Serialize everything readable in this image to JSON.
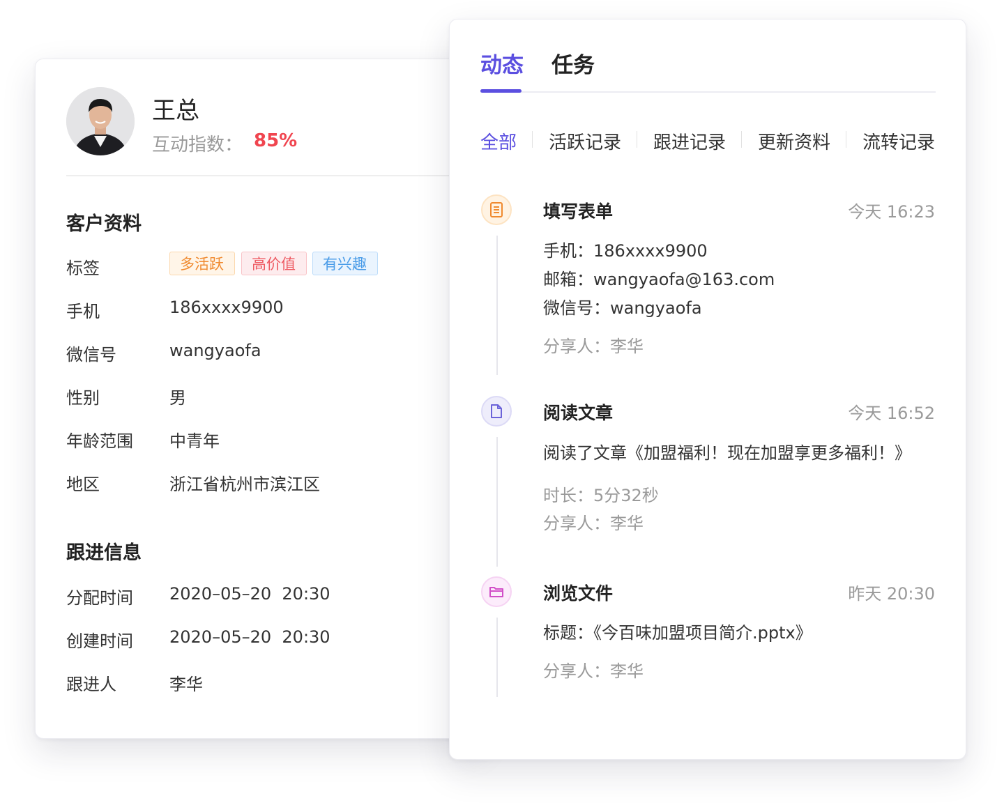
{
  "profile": {
    "name": "王总",
    "score_label": "互动指数：",
    "score_value": "85%"
  },
  "customer_info": {
    "title": "客户资料",
    "tags_label": "标签",
    "tags": [
      "多活跃",
      "高价值",
      "有兴趣"
    ],
    "rows": [
      {
        "label": "手机",
        "value": "186xxxx9900"
      },
      {
        "label": "微信号",
        "value": "wangyaofa"
      },
      {
        "label": "性别",
        "value": "男"
      },
      {
        "label": "年龄范围",
        "value": "中青年"
      },
      {
        "label": "地区",
        "value": "浙江省杭州市滨江区"
      }
    ]
  },
  "follow_info": {
    "title": "跟进信息",
    "rows": [
      {
        "label": "分配时间",
        "value": "2020–05–20  20:30"
      },
      {
        "label": "创建时间",
        "value": "2020–05–20  20:30"
      },
      {
        "label": "跟进人",
        "value": "李华"
      }
    ]
  },
  "tabs": [
    "动态",
    "任务"
  ],
  "active_tab": "动态",
  "filters": [
    "全部",
    "活跃记录",
    "跟进记录",
    "更新资料",
    "流转记录"
  ],
  "active_filter": "全部",
  "timeline": [
    {
      "icon": "form-icon",
      "title": "填写表单",
      "time": "今天 16:23",
      "lines": [
        "手机：186xxxx9900",
        "邮箱：wangyaofa@163.com",
        "微信号：wangyaofa"
      ],
      "meta": [
        "分享人：李华"
      ]
    },
    {
      "icon": "document-icon",
      "title": "阅读文章",
      "time": "今天 16:52",
      "lines": [
        "阅读了文章《加盟福利！现在加盟享更多福利！》"
      ],
      "meta": [
        "时长：5分32秒",
        "分享人：李华"
      ]
    },
    {
      "icon": "folder-icon",
      "title": "浏览文件",
      "time": "昨天 20:30",
      "lines": [
        "标题：《今百味加盟项目简介.pptx》"
      ],
      "meta": [
        "分享人：李华"
      ]
    }
  ],
  "colors": {
    "accent": "#5b4fe0",
    "score": "#f0454f",
    "form_icon": "#f08a2f",
    "document_icon": "#6b63d9",
    "folder_icon": "#d24fc8"
  }
}
